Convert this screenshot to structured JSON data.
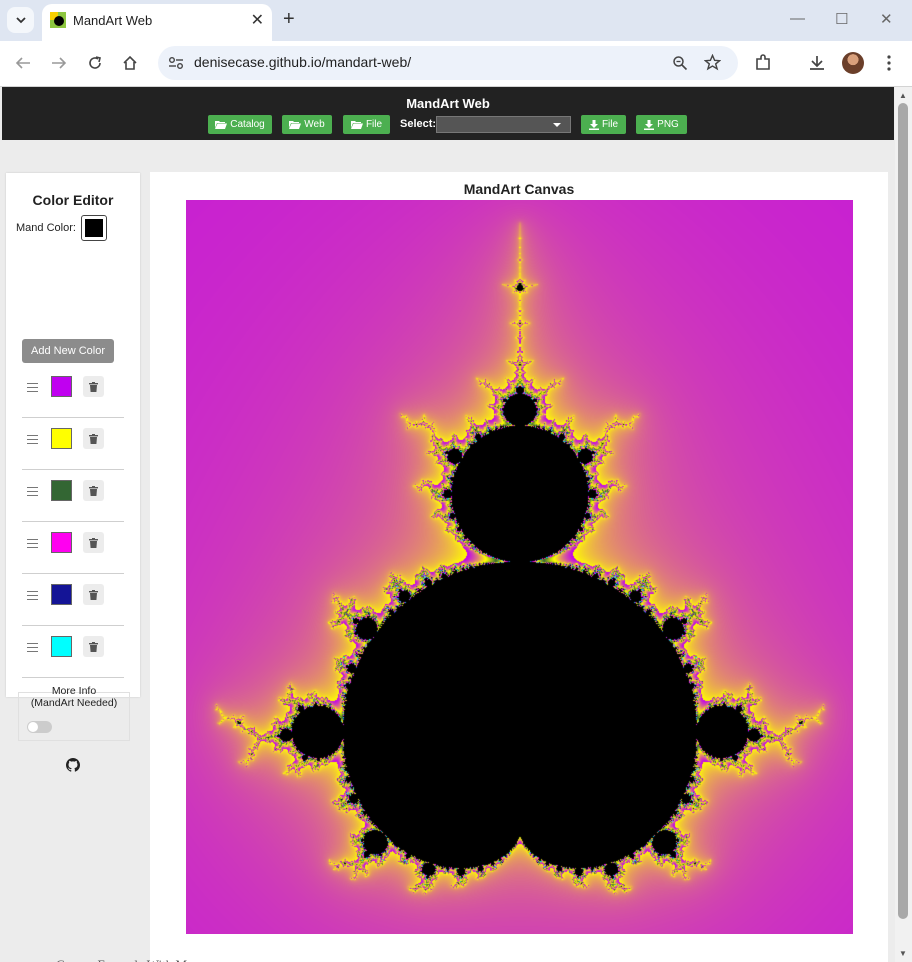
{
  "browser": {
    "tab_title": "MandArt Web",
    "url": "denisecase.github.io/mandart-web/"
  },
  "header": {
    "title": "MandArt Web",
    "buttons": {
      "catalog": "Catalog",
      "web": "Web",
      "file_open": "File",
      "file_download": "File",
      "png": "PNG"
    },
    "select_label": "Select:",
    "select_value": ""
  },
  "sidebar": {
    "title": "Color Editor",
    "mand_color_label": "Mand Color:",
    "mand_color": "#000000",
    "add_button": "Add New Color",
    "colors": [
      "#c000f0",
      "#ffff00",
      "#336633",
      "#ff00f0",
      "#141496",
      "#00ffff"
    ],
    "more_info_line1": "More Info",
    "more_info_line2": "(MandArt Needed)",
    "toggle_on": false
  },
  "canvas": {
    "title": "MandArt Canvas"
  },
  "footer_cutoff_text": "Canvas Example With Message"
}
